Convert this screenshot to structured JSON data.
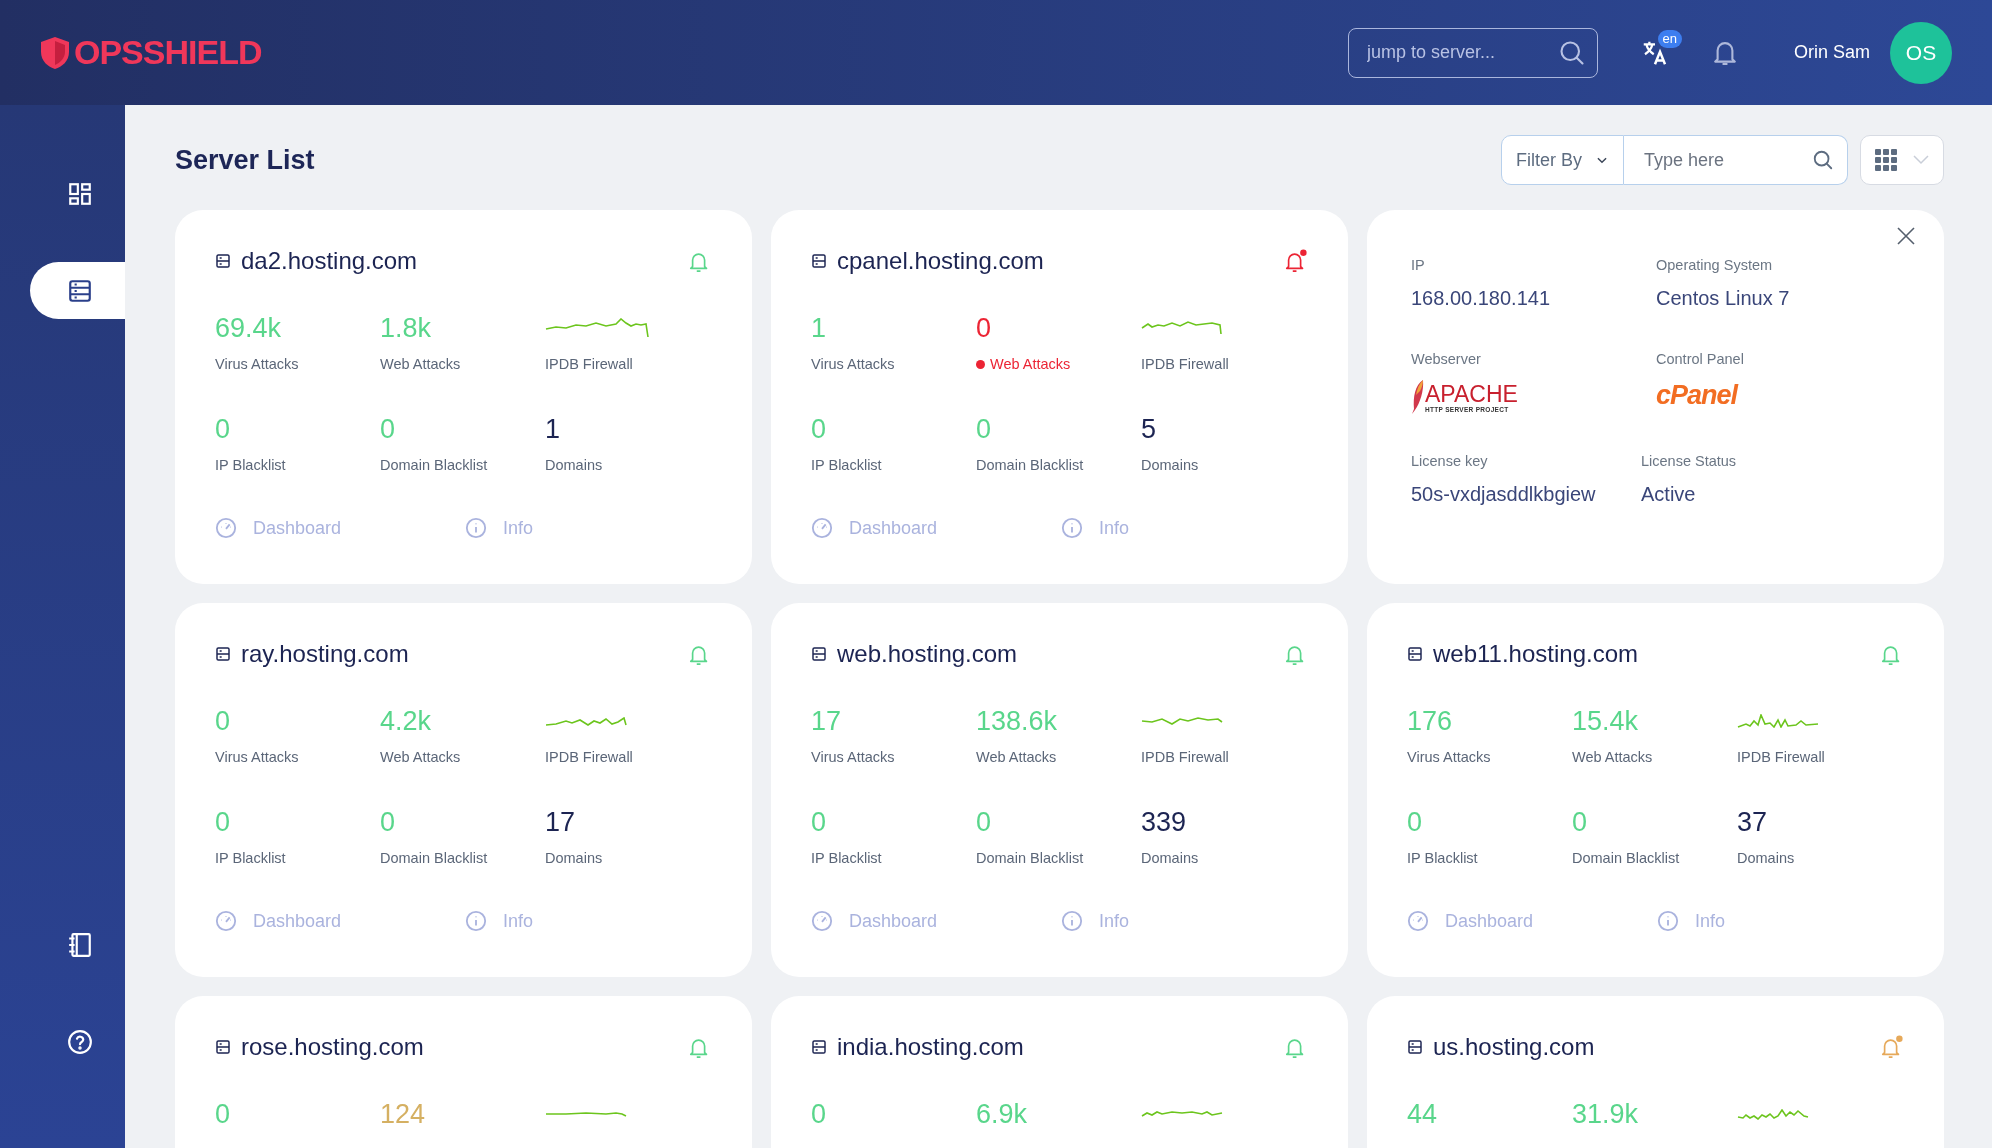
{
  "header": {
    "logo": "OPSSHIELD",
    "search": {
      "placeholder": "jump to server..."
    },
    "language": "en",
    "user": {
      "name": "Orin Sam",
      "initials": "OS"
    }
  },
  "sidebar": {
    "items": [
      {
        "kind": "dashboard",
        "selected": false
      },
      {
        "kind": "servers",
        "selected": true
      },
      {
        "kind": "notebook",
        "selected": false
      },
      {
        "kind": "help",
        "selected": false
      }
    ]
  },
  "page": {
    "title": "Server List",
    "filter": {
      "label": "Filter By"
    },
    "search": {
      "placeholder": "Type here"
    }
  },
  "servers": [
    {
      "kind": "server",
      "name": "da2.hosting.com",
      "bell": {
        "color": "#59d68b",
        "unread": false
      },
      "stats": [
        {
          "kind": "number",
          "value": "69.4k",
          "label": "Virus Attacks",
          "color": "#59d68b"
        },
        {
          "kind": "number",
          "value": "1.8k",
          "label": "Web Attacks",
          "color": "#59d68b"
        },
        {
          "kind": "sparkline",
          "label": "IPDB Firewall"
        },
        {
          "kind": "number",
          "value": "0",
          "label": "IP Blacklist",
          "color": "#59d68b"
        },
        {
          "kind": "number",
          "value": "0",
          "label": "Domain Blacklist",
          "color": "#59d68b"
        },
        {
          "kind": "number",
          "value": "1",
          "label": "Domains",
          "color": "#1c2452"
        }
      ],
      "links": [
        "Dashboard",
        "Info"
      ]
    },
    {
      "kind": "server",
      "name": "cpanel.hosting.com",
      "bell": {
        "color": "#ec2434",
        "unread": true
      },
      "stats": [
        {
          "kind": "number",
          "value": "1",
          "label": "Virus Attacks",
          "color": "#59d68b"
        },
        {
          "kind": "number",
          "value": "0",
          "label": "Web Attacks",
          "color": "#ec2434",
          "flagged": true
        },
        {
          "kind": "sparkline",
          "label": "IPDB Firewall"
        },
        {
          "kind": "number",
          "value": "0",
          "label": "IP Blacklist",
          "color": "#59d68b"
        },
        {
          "kind": "number",
          "value": "0",
          "label": "Domain Blacklist",
          "color": "#59d68b"
        },
        {
          "kind": "number",
          "value": "5",
          "label": "Domains",
          "color": "#1c2452"
        }
      ],
      "links": [
        "Dashboard",
        "Info"
      ]
    },
    {
      "kind": "info",
      "fields": [
        {
          "kind": "text",
          "label": "IP",
          "value": "168.00.180.141"
        },
        {
          "kind": "text",
          "label": "Operating System",
          "value": "Centos Linux 7"
        },
        {
          "kind": "apache",
          "label": "Webserver",
          "value": "APACHE",
          "subtitle": "HTTP SERVER PROJECT"
        },
        {
          "kind": "cpanel",
          "label": "Control Panel",
          "value": "cPanel"
        },
        {
          "kind": "text",
          "label": "License key",
          "value": "50s-vxdjasddlkbgiew"
        },
        {
          "kind": "text",
          "label": "License Status",
          "value": "Active"
        }
      ]
    },
    {
      "kind": "server",
      "name": "ray.hosting.com",
      "bell": {
        "color": "#59d68b",
        "unread": false
      },
      "stats": [
        {
          "kind": "number",
          "value": "0",
          "label": "Virus Attacks",
          "color": "#59d68b"
        },
        {
          "kind": "number",
          "value": "4.2k",
          "label": "Web Attacks",
          "color": "#59d68b"
        },
        {
          "kind": "sparkline",
          "label": "IPDB Firewall"
        },
        {
          "kind": "number",
          "value": "0",
          "label": "IP Blacklist",
          "color": "#59d68b"
        },
        {
          "kind": "number",
          "value": "0",
          "label": "Domain Blacklist",
          "color": "#59d68b"
        },
        {
          "kind": "number",
          "value": "17",
          "label": "Domains",
          "color": "#1c2452"
        }
      ],
      "links": [
        "Dashboard",
        "Info"
      ]
    },
    {
      "kind": "server",
      "name": "web.hosting.com",
      "bell": {
        "color": "#59d68b",
        "unread": false
      },
      "stats": [
        {
          "kind": "number",
          "value": "17",
          "label": "Virus Attacks",
          "color": "#59d68b"
        },
        {
          "kind": "number",
          "value": "138.6k",
          "label": "Web Attacks",
          "color": "#59d68b"
        },
        {
          "kind": "sparkline",
          "label": "IPDB Firewall"
        },
        {
          "kind": "number",
          "value": "0",
          "label": "IP Blacklist",
          "color": "#59d68b"
        },
        {
          "kind": "number",
          "value": "0",
          "label": "Domain Blacklist",
          "color": "#59d68b"
        },
        {
          "kind": "number",
          "value": "339",
          "label": "Domains",
          "color": "#1c2452"
        }
      ],
      "links": [
        "Dashboard",
        "Info"
      ]
    },
    {
      "kind": "server",
      "name": "web11.hosting.com",
      "bell": {
        "color": "#59d68b",
        "unread": false
      },
      "stats": [
        {
          "kind": "number",
          "value": "176",
          "label": "Virus Attacks",
          "color": "#59d68b"
        },
        {
          "kind": "number",
          "value": "15.4k",
          "label": "Web Attacks",
          "color": "#59d68b"
        },
        {
          "kind": "sparkline",
          "label": "IPDB Firewall"
        },
        {
          "kind": "number",
          "value": "0",
          "label": "IP Blacklist",
          "color": "#59d68b"
        },
        {
          "kind": "number",
          "value": "0",
          "label": "Domain Blacklist",
          "color": "#59d68b"
        },
        {
          "kind": "number",
          "value": "37",
          "label": "Domains",
          "color": "#1c2452"
        }
      ],
      "links": [
        "Dashboard",
        "Info"
      ]
    },
    {
      "kind": "server",
      "name": "rose.hosting.com",
      "bell": {
        "color": "#59d68b",
        "unread": false
      },
      "stats": [
        {
          "kind": "number",
          "value": "0",
          "color": "#59d68b"
        },
        {
          "kind": "number",
          "value": "124",
          "color": "#d5b062"
        },
        {
          "kind": "sparkline"
        }
      ]
    },
    {
      "kind": "server",
      "name": "india.hosting.com",
      "bell": {
        "color": "#59d68b",
        "unread": false
      },
      "stats": [
        {
          "kind": "number",
          "value": "0",
          "color": "#59d68b"
        },
        {
          "kind": "number",
          "value": "6.9k",
          "color": "#59d68b"
        },
        {
          "kind": "sparkline"
        }
      ]
    },
    {
      "kind": "server",
      "name": "us.hosting.com",
      "bell": {
        "color": "#e6a95a",
        "unread": true
      },
      "stats": [
        {
          "kind": "number",
          "value": "44",
          "color": "#59d68b"
        },
        {
          "kind": "number",
          "value": "31.9k",
          "color": "#59d68b"
        },
        {
          "kind": "sparkline"
        }
      ]
    }
  ]
}
